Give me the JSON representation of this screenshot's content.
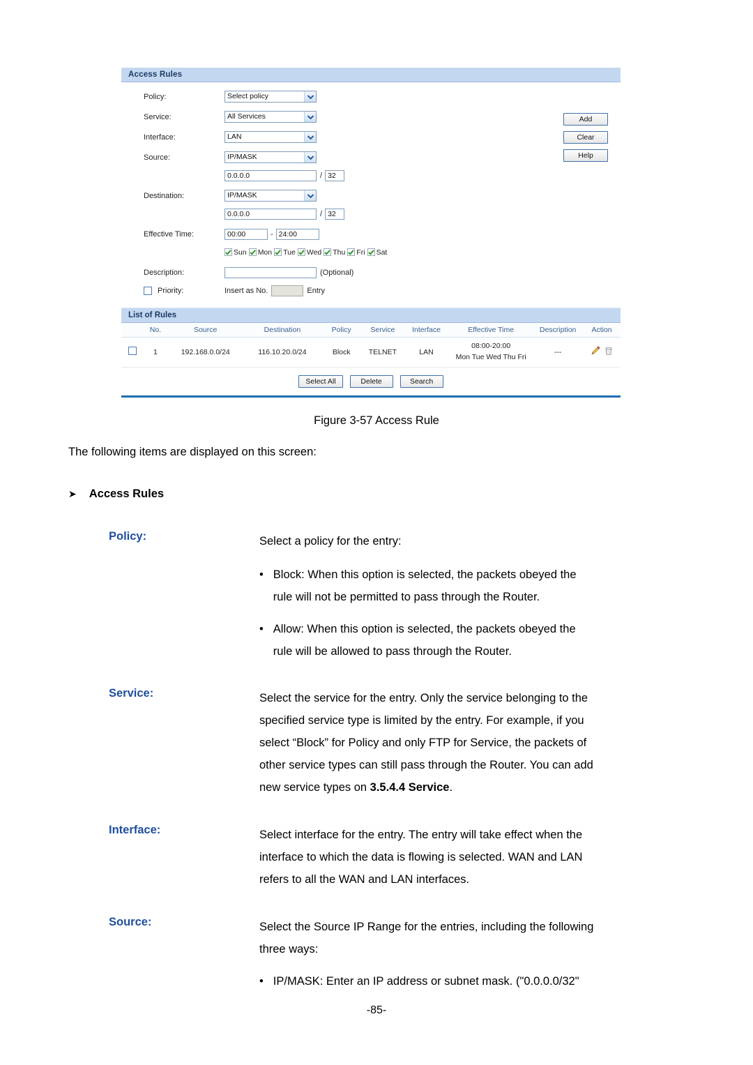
{
  "screenshot": {
    "access_rules_panel": {
      "title": "Access Rules",
      "fields": {
        "policy_label": "Policy:",
        "policy_value": "Select policy",
        "service_label": "Service:",
        "service_value": "All Services",
        "interface_label": "Interface:",
        "interface_value": "LAN",
        "source_label": "Source:",
        "source_type_value": "IP/MASK",
        "source_ip_value": "0.0.0.0",
        "source_mask_value": "32",
        "destination_label": "Destination:",
        "destination_type_value": "IP/MASK",
        "destination_ip_value": "0.0.0.0",
        "destination_mask_value": "32",
        "effective_time_label": "Effective Time:",
        "time_start_value": "00:00",
        "time_separator": "-",
        "time_end_value": "24:00",
        "description_label": "Description:",
        "description_value": "",
        "description_hint": "(Optional)",
        "priority_label": "Priority:",
        "priority_prefix": "Insert as No.",
        "priority_value": "",
        "priority_suffix": "Entry",
        "slash": "/"
      },
      "days": [
        {
          "label": "Sun",
          "checked": true
        },
        {
          "label": "Mon",
          "checked": true
        },
        {
          "label": "Tue",
          "checked": true
        },
        {
          "label": "Wed",
          "checked": true
        },
        {
          "label": "Thu",
          "checked": true
        },
        {
          "label": "Fri",
          "checked": true
        },
        {
          "label": "Sat",
          "checked": true
        }
      ],
      "side_buttons": [
        "Add",
        "Clear",
        "Help"
      ]
    },
    "list_of_rules": {
      "title": "List of Rules",
      "columns": [
        "",
        "No.",
        "Source",
        "Destination",
        "Policy",
        "Service",
        "Interface",
        "Effective Time",
        "Description",
        "Action"
      ],
      "rows": [
        {
          "no": "1",
          "source": "192.168.0.0/24",
          "destination": "116.10.20.0/24",
          "policy": "Block",
          "service": "TELNET",
          "interface": "LAN",
          "effective_time_range": "08:00-20:00",
          "effective_days": "Mon Tue Wed Thu Fri",
          "description": "---",
          "actions": [
            "edit-icon",
            "delete-icon"
          ]
        }
      ],
      "buttons": [
        "Select All",
        "Delete",
        "Search"
      ]
    },
    "colors": {
      "panel_header_bg": "#c3d8f0",
      "panel_header_text": "#1f3864",
      "table_header_text": "#34608f",
      "rule_line": "#1f6cb0",
      "button_border": "#3f6fa8",
      "check_green": "#2f9c2f",
      "edit_icon": "#e8a33d",
      "delete_icon": "#b0b0b0"
    }
  },
  "document": {
    "figure_caption": "Figure 3-57 Access Rule",
    "intro": "The following items are displayed on this screen:",
    "section_arrow": "➤",
    "section_title": "Access Rules",
    "terms": {
      "policy": {
        "label": "Policy:",
        "lead": "Select a policy for the entry:",
        "bullets": [
          {
            "marker": "•",
            "lines": [
              "Block: When this option is selected, the packets obeyed the",
              "rule will not be permitted to pass through the Router."
            ]
          },
          {
            "marker": "•",
            "lines": [
              "Allow: When this option is selected, the packets obeyed the",
              "rule will be allowed to pass through the Router."
            ]
          }
        ]
      },
      "service": {
        "label": "Service:",
        "lines": [
          "Select the service for the entry. Only the service belonging to the",
          "specified service type is limited by the entry. For example, if you",
          "select “Block” for Policy and only FTP for Service, the packets of",
          "other service types can still pass through the Router. You can add",
          "new service types on "
        ],
        "last_line_bold": "3.5.4.4 Service",
        "last_line_tail": "."
      },
      "interface": {
        "label": "Interface:",
        "lines": [
          "Select interface for the entry. The entry will take effect when the",
          "interface to which the data is flowing is selected. WAN and LAN",
          "refers to all the WAN and LAN interfaces."
        ]
      },
      "source": {
        "label": "Source:",
        "lines": [
          "Select the Source IP Range for the entries, including the following",
          "three ways:"
        ],
        "bullets": [
          {
            "marker": "•",
            "lines": [
              "IP/MASK: Enter an IP address or subnet mask. (\"0.0.0.0/32\""
            ]
          }
        ]
      }
    },
    "page_number": "-85-"
  }
}
